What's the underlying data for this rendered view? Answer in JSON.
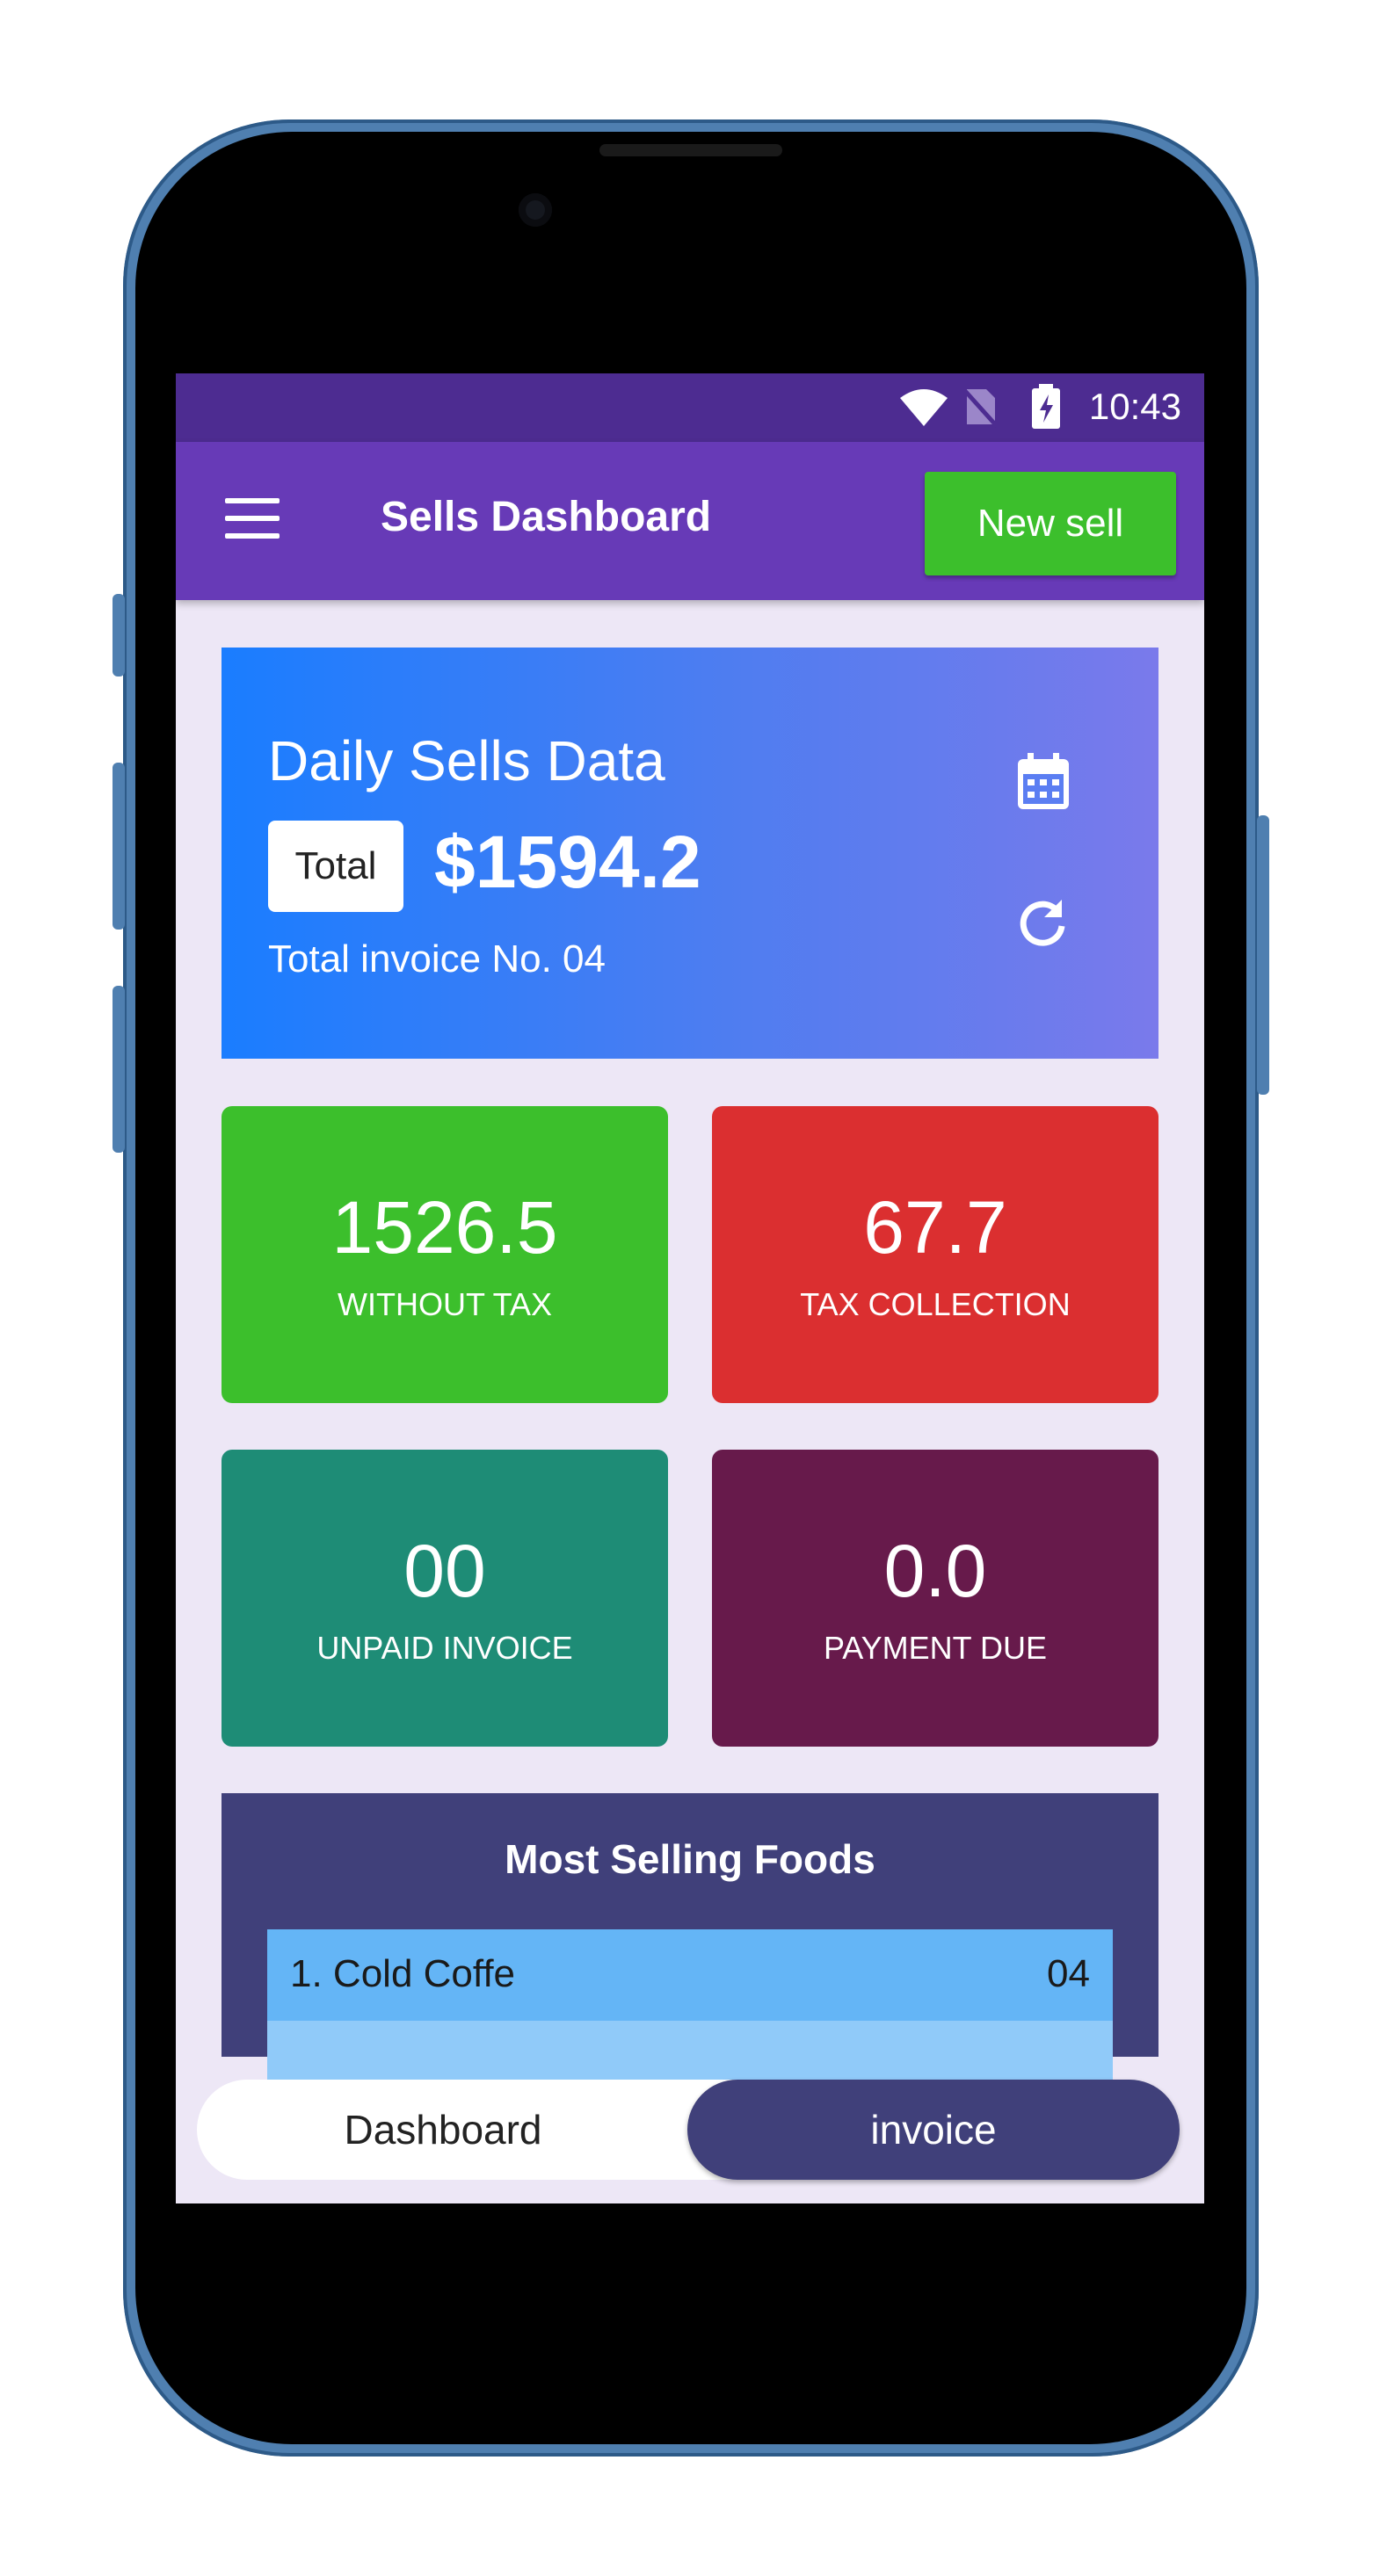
{
  "status_bar": {
    "time": "10:43",
    "icons": [
      "wifi-icon",
      "no-sim-icon",
      "battery-charging-icon"
    ]
  },
  "app_bar": {
    "menu_icon": "hamburger-menu-icon",
    "title": "Sells Dashboard",
    "new_sell_label": "New sell"
  },
  "daily_card": {
    "title": "Daily Sells Data",
    "total_badge": "Total",
    "total_amount": "$1594.2",
    "invoice_text": "Total invoice No. 04",
    "icons": [
      "calendar-icon",
      "refresh-icon"
    ]
  },
  "stats": [
    {
      "value": "1526.5",
      "label": "WITHOUT TAX",
      "color": "#3cbf2c"
    },
    {
      "value": "67.7",
      "label": "TAX COLLECTION",
      "color": "#db2f30"
    },
    {
      "value": "00",
      "label": "UNPAID INVOICE",
      "color": "#1e8c76"
    },
    {
      "value": "0.0",
      "label": "PAYMENT DUE",
      "color": "#671a4b"
    }
  ],
  "foods": {
    "title": "Most Selling Foods",
    "items": [
      {
        "name": "1. Cold Coffe",
        "count": "04"
      }
    ]
  },
  "bottom_nav": {
    "dashboard": "Dashboard",
    "invoice": "invoice"
  },
  "colors": {
    "status_bar": "#4d2c91",
    "app_bar": "#673ab7",
    "screen_bg": "#ede7f6",
    "accent_green": "#3cbf2c",
    "panel": "#40407a"
  }
}
